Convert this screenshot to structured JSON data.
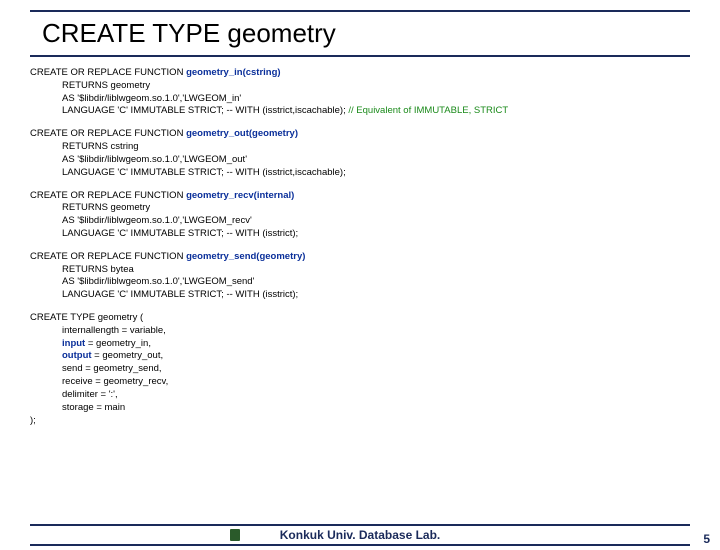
{
  "title": "CREATE TYPE geometry",
  "blocks": [
    {
      "head_pre": "CREATE OR REPLACE FUNCTION ",
      "fn": "geometry_in(cstring)",
      "lines": [
        "RETURNS geometry",
        "AS '$libdir/liblwgeom.so.1.0','LWGEOM_in'"
      ],
      "lang": "LANGUAGE 'C' IMMUTABLE STRICT; -- WITH (isstrict,iscachable); ",
      "comment": "// Equivalent of IMMUTABLE, STRICT"
    },
    {
      "head_pre": "CREATE OR REPLACE FUNCTION ",
      "fn": "geometry_out(geometry)",
      "lines": [
        "RETURNS cstring",
        "AS '$libdir/liblwgeom.so.1.0','LWGEOM_out'"
      ],
      "lang": "LANGUAGE 'C' IMMUTABLE STRICT; -- WITH (isstrict,iscachable);",
      "comment": ""
    },
    {
      "head_pre": "CREATE OR REPLACE FUNCTION ",
      "fn": "geometry_recv(internal)",
      "lines": [
        "RETURNS geometry",
        "AS '$libdir/liblwgeom.so.1.0','LWGEOM_recv'"
      ],
      "lang": "LANGUAGE 'C' IMMUTABLE STRICT; -- WITH (isstrict);",
      "comment": ""
    },
    {
      "head_pre": "CREATE OR REPLACE FUNCTION ",
      "fn": "geometry_send(geometry)",
      "lines": [
        "RETURNS bytea",
        "AS '$libdir/liblwgeom.so.1.0','LWGEOM_send'"
      ],
      "lang": "LANGUAGE 'C' IMMUTABLE STRICT; -- WITH (isstrict);",
      "comment": ""
    }
  ],
  "ctype_head": "CREATE TYPE geometry (",
  "ctype_lines_pre_io": [
    "internallength = variable,"
  ],
  "ctype_input_kw": "input",
  "ctype_input_rest": " = geometry_in,",
  "ctype_output_kw": "output",
  "ctype_output_rest": " = geometry_out,",
  "ctype_lines_post_io": [
    "send = geometry_send,",
    "receive = geometry_recv,",
    "delimiter = ':',",
    "storage = main"
  ],
  "ctype_close": ");",
  "footer": "Konkuk Univ. Database Lab.",
  "page": "5"
}
